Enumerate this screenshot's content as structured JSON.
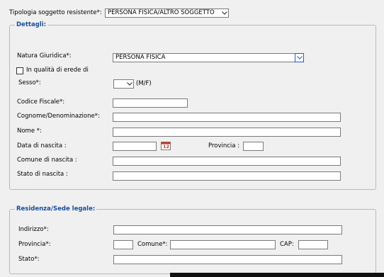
{
  "top": {
    "tipologia_label": "Tipologia soggetto resistente*:",
    "tipologia_value": "PERSONA FISICA/ALTRO SOGGETTO"
  },
  "dettagli": {
    "legend": "Dettagli:",
    "natura_label": "Natura Giuridica*:",
    "natura_value": "PERSONA FISICA",
    "erede_label": "In qualità di erede di",
    "sesso_label": "Sesso*:",
    "sesso_value": "",
    "sesso_hint": "(M/F)",
    "codice_fiscale_label": "Codice Fiscale*:",
    "codice_fiscale_value": "",
    "cognome_label": "Cognome/Denominazione*:",
    "cognome_value": "",
    "nome_label": "Nome *:",
    "nome_value": "",
    "data_nascita_label": "Data di nascita :",
    "data_nascita_value": "",
    "calendar_text": "12",
    "provincia_label": "Provincia :",
    "provincia_value": "",
    "comune_label": "Comune di nascita :",
    "comune_value": "",
    "stato_label": "Stato di nascita :",
    "stato_value": ""
  },
  "residenza": {
    "legend": "Residenza/Sede legale:",
    "indirizzo_label": "Indirizzo*:",
    "indirizzo_value": "",
    "provincia_label": "Provincia*:",
    "provincia_value": "",
    "comune_label": "Comune*:",
    "comune_value": "",
    "cap_label": "CAP:",
    "cap_value": "",
    "stato_label": "Stato*:",
    "stato_value": ""
  },
  "colors": {
    "legend": "#1a4d9c",
    "focus_border": "#1c5fc9"
  },
  "icons": {
    "dropdown": "chevron-down-icon",
    "calendar": "calendar-icon"
  }
}
